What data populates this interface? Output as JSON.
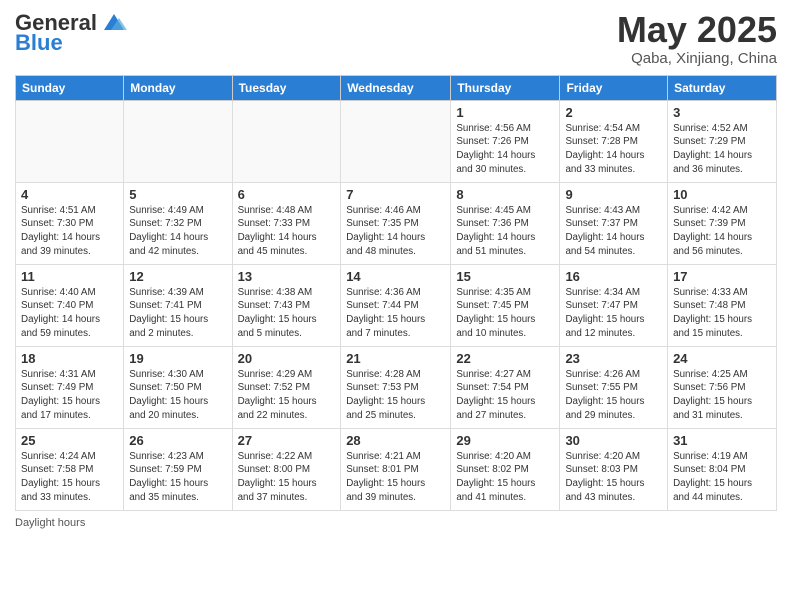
{
  "header": {
    "logo_general": "General",
    "logo_blue": "Blue",
    "month_title": "May 2025",
    "location": "Qaba, Xinjiang, China"
  },
  "weekdays": [
    "Sunday",
    "Monday",
    "Tuesday",
    "Wednesday",
    "Thursday",
    "Friday",
    "Saturday"
  ],
  "footer_text": "Daylight hours",
  "weeks": [
    [
      {
        "day": "",
        "info": ""
      },
      {
        "day": "",
        "info": ""
      },
      {
        "day": "",
        "info": ""
      },
      {
        "day": "",
        "info": ""
      },
      {
        "day": "1",
        "info": "Sunrise: 4:56 AM\nSunset: 7:26 PM\nDaylight: 14 hours\nand 30 minutes."
      },
      {
        "day": "2",
        "info": "Sunrise: 4:54 AM\nSunset: 7:28 PM\nDaylight: 14 hours\nand 33 minutes."
      },
      {
        "day": "3",
        "info": "Sunrise: 4:52 AM\nSunset: 7:29 PM\nDaylight: 14 hours\nand 36 minutes."
      }
    ],
    [
      {
        "day": "4",
        "info": "Sunrise: 4:51 AM\nSunset: 7:30 PM\nDaylight: 14 hours\nand 39 minutes."
      },
      {
        "day": "5",
        "info": "Sunrise: 4:49 AM\nSunset: 7:32 PM\nDaylight: 14 hours\nand 42 minutes."
      },
      {
        "day": "6",
        "info": "Sunrise: 4:48 AM\nSunset: 7:33 PM\nDaylight: 14 hours\nand 45 minutes."
      },
      {
        "day": "7",
        "info": "Sunrise: 4:46 AM\nSunset: 7:35 PM\nDaylight: 14 hours\nand 48 minutes."
      },
      {
        "day": "8",
        "info": "Sunrise: 4:45 AM\nSunset: 7:36 PM\nDaylight: 14 hours\nand 51 minutes."
      },
      {
        "day": "9",
        "info": "Sunrise: 4:43 AM\nSunset: 7:37 PM\nDaylight: 14 hours\nand 54 minutes."
      },
      {
        "day": "10",
        "info": "Sunrise: 4:42 AM\nSunset: 7:39 PM\nDaylight: 14 hours\nand 56 minutes."
      }
    ],
    [
      {
        "day": "11",
        "info": "Sunrise: 4:40 AM\nSunset: 7:40 PM\nDaylight: 14 hours\nand 59 minutes."
      },
      {
        "day": "12",
        "info": "Sunrise: 4:39 AM\nSunset: 7:41 PM\nDaylight: 15 hours\nand 2 minutes."
      },
      {
        "day": "13",
        "info": "Sunrise: 4:38 AM\nSunset: 7:43 PM\nDaylight: 15 hours\nand 5 minutes."
      },
      {
        "day": "14",
        "info": "Sunrise: 4:36 AM\nSunset: 7:44 PM\nDaylight: 15 hours\nand 7 minutes."
      },
      {
        "day": "15",
        "info": "Sunrise: 4:35 AM\nSunset: 7:45 PM\nDaylight: 15 hours\nand 10 minutes."
      },
      {
        "day": "16",
        "info": "Sunrise: 4:34 AM\nSunset: 7:47 PM\nDaylight: 15 hours\nand 12 minutes."
      },
      {
        "day": "17",
        "info": "Sunrise: 4:33 AM\nSunset: 7:48 PM\nDaylight: 15 hours\nand 15 minutes."
      }
    ],
    [
      {
        "day": "18",
        "info": "Sunrise: 4:31 AM\nSunset: 7:49 PM\nDaylight: 15 hours\nand 17 minutes."
      },
      {
        "day": "19",
        "info": "Sunrise: 4:30 AM\nSunset: 7:50 PM\nDaylight: 15 hours\nand 20 minutes."
      },
      {
        "day": "20",
        "info": "Sunrise: 4:29 AM\nSunset: 7:52 PM\nDaylight: 15 hours\nand 22 minutes."
      },
      {
        "day": "21",
        "info": "Sunrise: 4:28 AM\nSunset: 7:53 PM\nDaylight: 15 hours\nand 25 minutes."
      },
      {
        "day": "22",
        "info": "Sunrise: 4:27 AM\nSunset: 7:54 PM\nDaylight: 15 hours\nand 27 minutes."
      },
      {
        "day": "23",
        "info": "Sunrise: 4:26 AM\nSunset: 7:55 PM\nDaylight: 15 hours\nand 29 minutes."
      },
      {
        "day": "24",
        "info": "Sunrise: 4:25 AM\nSunset: 7:56 PM\nDaylight: 15 hours\nand 31 minutes."
      }
    ],
    [
      {
        "day": "25",
        "info": "Sunrise: 4:24 AM\nSunset: 7:58 PM\nDaylight: 15 hours\nand 33 minutes."
      },
      {
        "day": "26",
        "info": "Sunrise: 4:23 AM\nSunset: 7:59 PM\nDaylight: 15 hours\nand 35 minutes."
      },
      {
        "day": "27",
        "info": "Sunrise: 4:22 AM\nSunset: 8:00 PM\nDaylight: 15 hours\nand 37 minutes."
      },
      {
        "day": "28",
        "info": "Sunrise: 4:21 AM\nSunset: 8:01 PM\nDaylight: 15 hours\nand 39 minutes."
      },
      {
        "day": "29",
        "info": "Sunrise: 4:20 AM\nSunset: 8:02 PM\nDaylight: 15 hours\nand 41 minutes."
      },
      {
        "day": "30",
        "info": "Sunrise: 4:20 AM\nSunset: 8:03 PM\nDaylight: 15 hours\nand 43 minutes."
      },
      {
        "day": "31",
        "info": "Sunrise: 4:19 AM\nSunset: 8:04 PM\nDaylight: 15 hours\nand 44 minutes."
      }
    ]
  ]
}
